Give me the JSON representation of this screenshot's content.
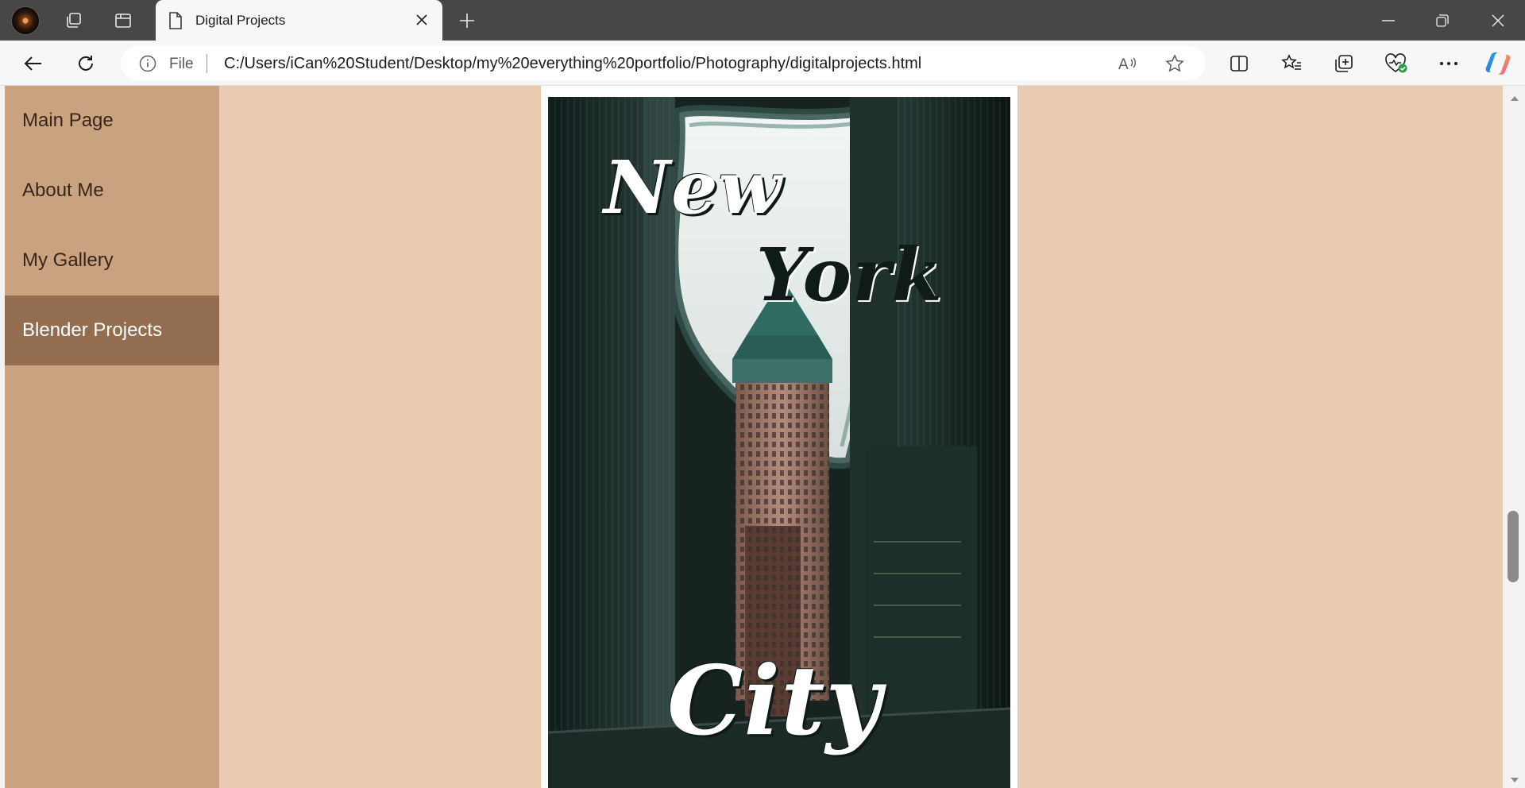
{
  "browser": {
    "tab": {
      "title": "Digital Projects"
    },
    "address": {
      "scheme": "File",
      "url": "C:/Users/iCan%20Student/Desktop/my%20everything%20portfolio/Photography/digitalprojects.html"
    }
  },
  "page": {
    "nav": {
      "items": [
        {
          "label": "Main Page"
        },
        {
          "label": "About Me"
        },
        {
          "label": "My Gallery"
        },
        {
          "label": "Blender Projects"
        }
      ],
      "active_index": 3
    },
    "poster": {
      "word1": "New",
      "word2": "York",
      "word3": "City"
    }
  },
  "colors": {
    "page_bg": "#e8cbb0",
    "sidebar_bg": "#c9a27f",
    "sidebar_active": "#936d4f",
    "titlebar": "#474747"
  }
}
